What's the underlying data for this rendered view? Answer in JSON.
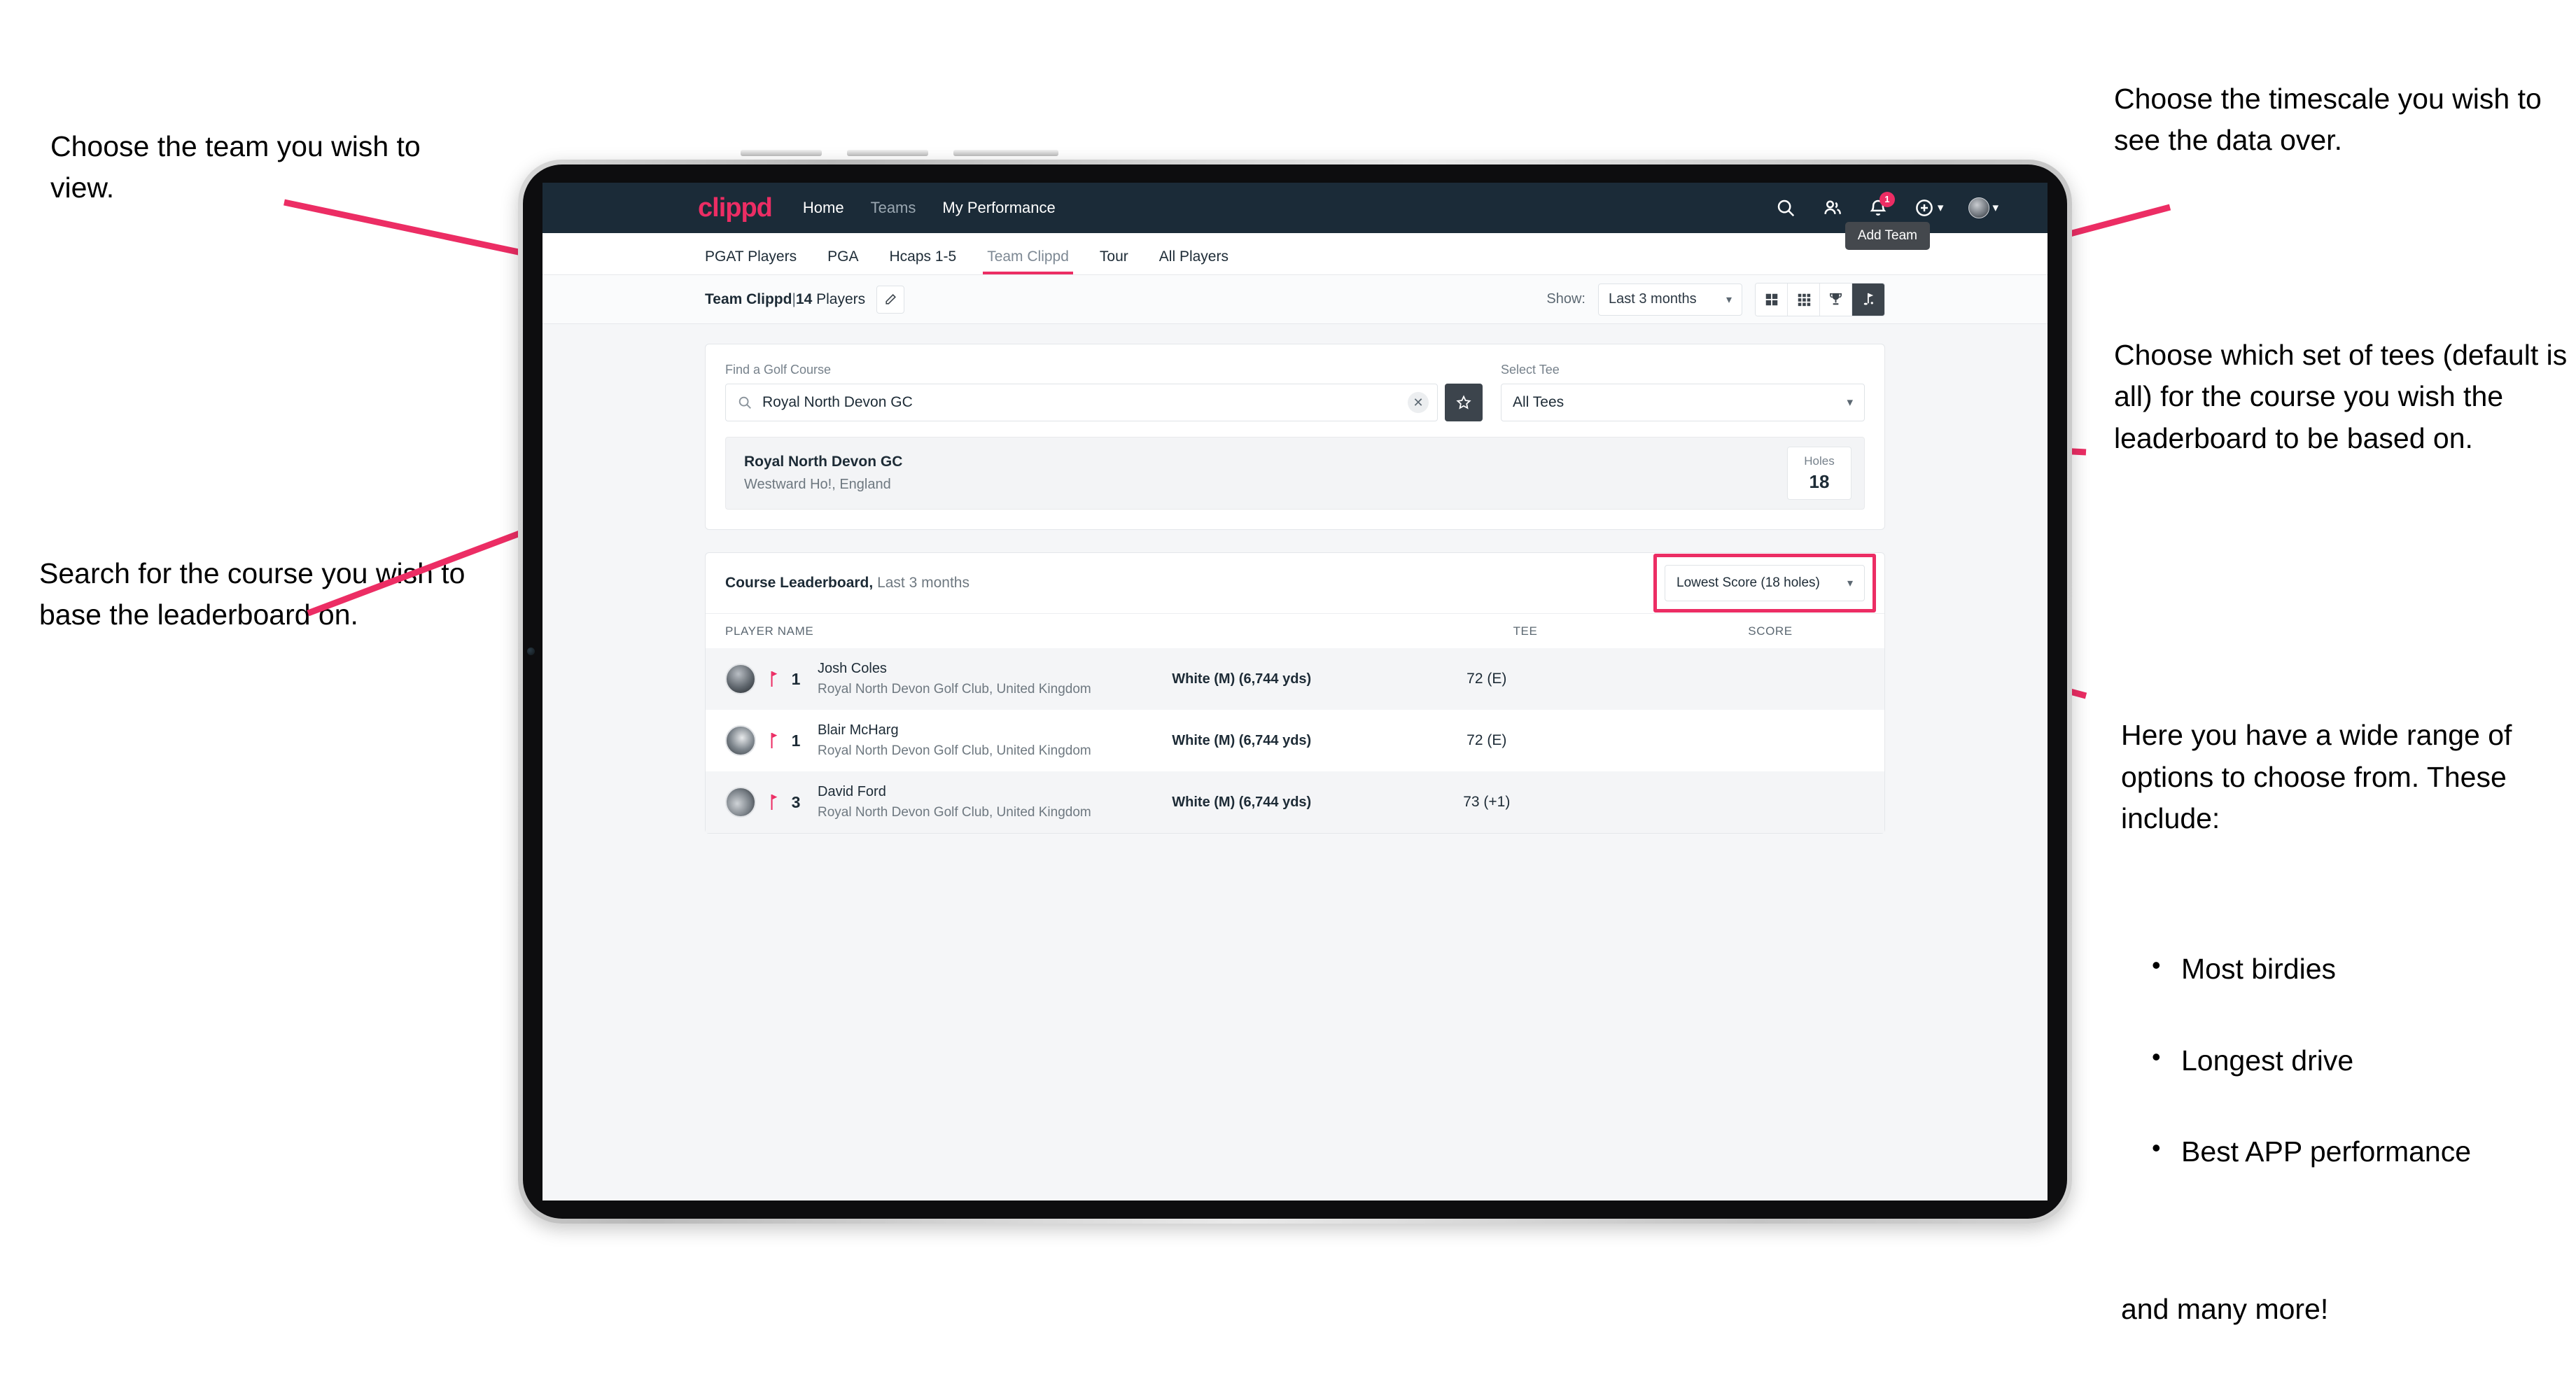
{
  "annotations": {
    "top_left": "Choose the team you wish to view.",
    "bottom_left": "Search for the course you wish to base the leaderboard on.",
    "top_right": "Choose the timescale you wish to see the data over.",
    "mid_right": "Choose which set of tees (default is all) for the course you wish the leaderboard to be based on.",
    "bottom_right_intro": "Here you have a wide range of options to choose from. These include:",
    "bottom_right_list": [
      "Most birdies",
      "Longest drive",
      "Best APP performance"
    ],
    "bottom_right_tail": "and many more!"
  },
  "colors": {
    "accent": "#ec2d64",
    "appbar": "#1b2b38",
    "dark_button": "#3c444c",
    "page_bg": "#f5f6f8"
  },
  "appbar": {
    "brand": "clippd",
    "nav": [
      {
        "label": "Home",
        "active": true
      },
      {
        "label": "Teams",
        "active": false
      },
      {
        "label": "My Performance",
        "active": true
      }
    ],
    "icons": [
      "search-icon",
      "people-icon",
      "bell-icon",
      "plus-circle-icon",
      "avatar-icon"
    ],
    "notification_count": "1"
  },
  "tabs": {
    "items": [
      {
        "label": "PGAT Players",
        "active": false
      },
      {
        "label": "PGA",
        "active": false
      },
      {
        "label": "Hcaps 1-5",
        "active": false
      },
      {
        "label": "Team Clippd",
        "active": true
      },
      {
        "label": "Tour",
        "active": false
      },
      {
        "label": "All Players",
        "active": false
      }
    ],
    "tooltip": "Add Team"
  },
  "subbar": {
    "team_name": "Team Clippd",
    "separator": "|",
    "player_count": "14",
    "players_word": "Players",
    "edit_icon": "pencil-icon",
    "show_label": "Show:",
    "timescale_value": "Last 3 months",
    "view_toggles": [
      {
        "icon": "grid-4-icon",
        "active": false
      },
      {
        "icon": "grid-9-icon",
        "active": false
      },
      {
        "icon": "trophy-icon",
        "active": false
      },
      {
        "icon": "golf-flag-icon",
        "active": true
      }
    ]
  },
  "search_panel": {
    "course_label": "Find a Golf Course",
    "course_value": "Royal North Devon GC",
    "course_placeholder": "Find a Golf Course",
    "clear_icon": "close-icon",
    "star_icon": "star-icon",
    "tee_label": "Select Tee",
    "tee_value": "All Tees"
  },
  "course_result": {
    "name": "Royal North Devon GC",
    "location": "Westward Ho!, England",
    "holes_label": "Holes",
    "holes_value": "18"
  },
  "leaderboard": {
    "title": "Course Leaderboard,",
    "subtitle": "Last 3 months",
    "sort_value": "Lowest Score (18 holes)",
    "columns": [
      "PLAYER NAME",
      "TEE",
      "SCORE"
    ],
    "rows": [
      {
        "rank": "1",
        "name": "Josh Coles",
        "club": "Royal North Devon Golf Club, United Kingdom",
        "tee": "White (M) (6,744 yds)",
        "score": "72 (E)"
      },
      {
        "rank": "1",
        "name": "Blair McHarg",
        "club": "Royal North Devon Golf Club, United Kingdom",
        "tee": "White (M) (6,744 yds)",
        "score": "72 (E)"
      },
      {
        "rank": "3",
        "name": "David Ford",
        "club": "Royal North Devon Golf Club, United Kingdom",
        "tee": "White (M) (6,744 yds)",
        "score": "73 (+1)"
      }
    ]
  }
}
